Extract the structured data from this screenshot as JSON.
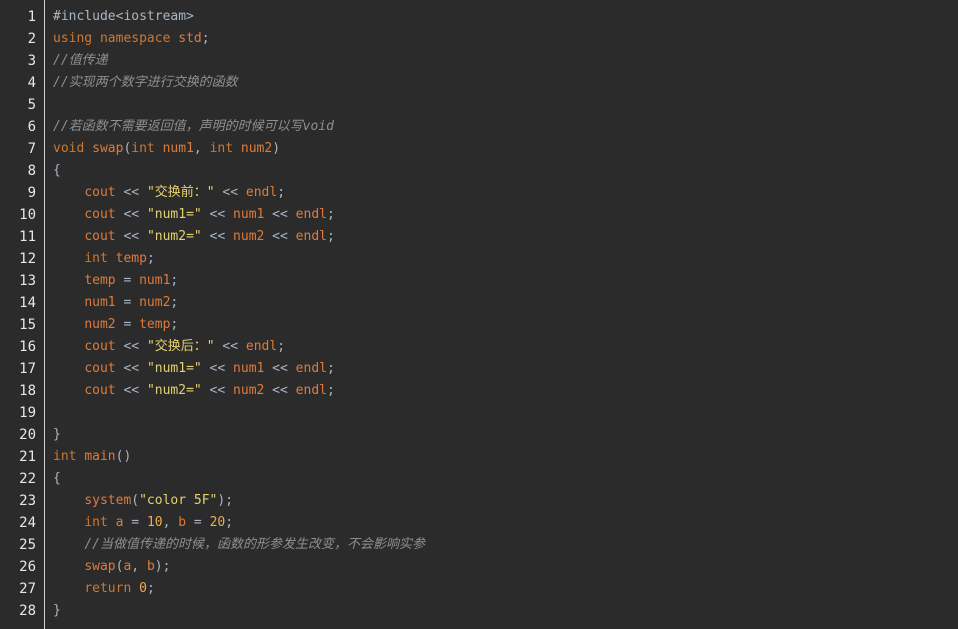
{
  "editor": {
    "colors": {
      "background": "#2b2b2b",
      "gutter_border": "#d0d0d0",
      "line_number": "#e8e8e8",
      "keyword": "#cc7832",
      "comment": "#8f8f8f",
      "string": "#e5d16f",
      "text": "#a9b7c6"
    },
    "lines": [
      {
        "n": "1",
        "tokens": [
          {
            "t": "#include<iostream>",
            "c": "k-pp"
          }
        ]
      },
      {
        "n": "2",
        "tokens": [
          {
            "t": "using",
            "c": "k-kw"
          },
          {
            "t": " ",
            "c": "k-tx"
          },
          {
            "t": "namespace",
            "c": "k-kw"
          },
          {
            "t": " ",
            "c": "k-tx"
          },
          {
            "t": "std",
            "c": "k-id"
          },
          {
            "t": ";",
            "c": "k-tx"
          }
        ]
      },
      {
        "n": "3",
        "tokens": [
          {
            "t": "//值传递",
            "c": "k-cm"
          }
        ]
      },
      {
        "n": "4",
        "tokens": [
          {
            "t": "//实现两个数字进行交换的函数",
            "c": "k-cm"
          }
        ]
      },
      {
        "n": "5",
        "tokens": []
      },
      {
        "n": "6",
        "tokens": [
          {
            "t": "//若函数不需要返回值，声明的时候可以写void",
            "c": "k-cm"
          }
        ]
      },
      {
        "n": "7",
        "tokens": [
          {
            "t": "void",
            "c": "k-kw"
          },
          {
            "t": " ",
            "c": "k-tx"
          },
          {
            "t": "swap",
            "c": "k-id"
          },
          {
            "t": "(",
            "c": "k-tx"
          },
          {
            "t": "int",
            "c": "k-kw"
          },
          {
            "t": " ",
            "c": "k-tx"
          },
          {
            "t": "num1",
            "c": "k-id"
          },
          {
            "t": ", ",
            "c": "k-tx"
          },
          {
            "t": "int",
            "c": "k-kw"
          },
          {
            "t": " ",
            "c": "k-tx"
          },
          {
            "t": "num2",
            "c": "k-id"
          },
          {
            "t": ")",
            "c": "k-tx"
          }
        ]
      },
      {
        "n": "8",
        "tokens": [
          {
            "t": "{",
            "c": "k-tx"
          }
        ]
      },
      {
        "n": "9",
        "tokens": [
          {
            "t": "    ",
            "c": "k-tx"
          },
          {
            "t": "cout",
            "c": "k-id"
          },
          {
            "t": " << ",
            "c": "k-tx"
          },
          {
            "t": "\"交换前：\"",
            "c": "k-str"
          },
          {
            "t": " << ",
            "c": "k-tx"
          },
          {
            "t": "endl",
            "c": "k-id"
          },
          {
            "t": ";",
            "c": "k-tx"
          }
        ]
      },
      {
        "n": "10",
        "tokens": [
          {
            "t": "    ",
            "c": "k-tx"
          },
          {
            "t": "cout",
            "c": "k-id"
          },
          {
            "t": " << ",
            "c": "k-tx"
          },
          {
            "t": "\"num1=\"",
            "c": "k-str"
          },
          {
            "t": " << ",
            "c": "k-tx"
          },
          {
            "t": "num1",
            "c": "k-id"
          },
          {
            "t": " << ",
            "c": "k-tx"
          },
          {
            "t": "endl",
            "c": "k-id"
          },
          {
            "t": ";",
            "c": "k-tx"
          }
        ]
      },
      {
        "n": "11",
        "tokens": [
          {
            "t": "    ",
            "c": "k-tx"
          },
          {
            "t": "cout",
            "c": "k-id"
          },
          {
            "t": " << ",
            "c": "k-tx"
          },
          {
            "t": "\"num2=\"",
            "c": "k-str"
          },
          {
            "t": " << ",
            "c": "k-tx"
          },
          {
            "t": "num2",
            "c": "k-id"
          },
          {
            "t": " << ",
            "c": "k-tx"
          },
          {
            "t": "endl",
            "c": "k-id"
          },
          {
            "t": ";",
            "c": "k-tx"
          }
        ]
      },
      {
        "n": "12",
        "tokens": [
          {
            "t": "    ",
            "c": "k-tx"
          },
          {
            "t": "int",
            "c": "k-kw"
          },
          {
            "t": " ",
            "c": "k-tx"
          },
          {
            "t": "temp",
            "c": "k-id"
          },
          {
            "t": ";",
            "c": "k-tx"
          }
        ]
      },
      {
        "n": "13",
        "tokens": [
          {
            "t": "    ",
            "c": "k-tx"
          },
          {
            "t": "temp",
            "c": "k-id"
          },
          {
            "t": " = ",
            "c": "k-tx"
          },
          {
            "t": "num1",
            "c": "k-id"
          },
          {
            "t": ";",
            "c": "k-tx"
          }
        ]
      },
      {
        "n": "14",
        "tokens": [
          {
            "t": "    ",
            "c": "k-tx"
          },
          {
            "t": "num1",
            "c": "k-id"
          },
          {
            "t": " = ",
            "c": "k-tx"
          },
          {
            "t": "num2",
            "c": "k-id"
          },
          {
            "t": ";",
            "c": "k-tx"
          }
        ]
      },
      {
        "n": "15",
        "tokens": [
          {
            "t": "    ",
            "c": "k-tx"
          },
          {
            "t": "num2",
            "c": "k-id"
          },
          {
            "t": " = ",
            "c": "k-tx"
          },
          {
            "t": "temp",
            "c": "k-id"
          },
          {
            "t": ";",
            "c": "k-tx"
          }
        ]
      },
      {
        "n": "16",
        "tokens": [
          {
            "t": "    ",
            "c": "k-tx"
          },
          {
            "t": "cout",
            "c": "k-id"
          },
          {
            "t": " << ",
            "c": "k-tx"
          },
          {
            "t": "\"交换后：\"",
            "c": "k-str"
          },
          {
            "t": " << ",
            "c": "k-tx"
          },
          {
            "t": "endl",
            "c": "k-id"
          },
          {
            "t": ";",
            "c": "k-tx"
          }
        ]
      },
      {
        "n": "17",
        "tokens": [
          {
            "t": "    ",
            "c": "k-tx"
          },
          {
            "t": "cout",
            "c": "k-id"
          },
          {
            "t": " << ",
            "c": "k-tx"
          },
          {
            "t": "\"num1=\"",
            "c": "k-str"
          },
          {
            "t": " << ",
            "c": "k-tx"
          },
          {
            "t": "num1",
            "c": "k-id"
          },
          {
            "t": " << ",
            "c": "k-tx"
          },
          {
            "t": "endl",
            "c": "k-id"
          },
          {
            "t": ";",
            "c": "k-tx"
          }
        ]
      },
      {
        "n": "18",
        "tokens": [
          {
            "t": "    ",
            "c": "k-tx"
          },
          {
            "t": "cout",
            "c": "k-id"
          },
          {
            "t": " << ",
            "c": "k-tx"
          },
          {
            "t": "\"num2=\"",
            "c": "k-str"
          },
          {
            "t": " << ",
            "c": "k-tx"
          },
          {
            "t": "num2",
            "c": "k-id"
          },
          {
            "t": " << ",
            "c": "k-tx"
          },
          {
            "t": "endl",
            "c": "k-id"
          },
          {
            "t": ";",
            "c": "k-tx"
          }
        ]
      },
      {
        "n": "19",
        "tokens": []
      },
      {
        "n": "20",
        "tokens": [
          {
            "t": "}",
            "c": "k-tx"
          }
        ]
      },
      {
        "n": "21",
        "tokens": [
          {
            "t": "int",
            "c": "k-kw"
          },
          {
            "t": " ",
            "c": "k-tx"
          },
          {
            "t": "main",
            "c": "k-id"
          },
          {
            "t": "()",
            "c": "k-tx"
          }
        ]
      },
      {
        "n": "22",
        "tokens": [
          {
            "t": "{",
            "c": "k-tx"
          }
        ]
      },
      {
        "n": "23",
        "tokens": [
          {
            "t": "    ",
            "c": "k-tx"
          },
          {
            "t": "system",
            "c": "k-id"
          },
          {
            "t": "(",
            "c": "k-tx"
          },
          {
            "t": "\"color 5F\"",
            "c": "k-str"
          },
          {
            "t": ");",
            "c": "k-tx"
          }
        ]
      },
      {
        "n": "24",
        "tokens": [
          {
            "t": "    ",
            "c": "k-tx"
          },
          {
            "t": "int",
            "c": "k-kw"
          },
          {
            "t": " ",
            "c": "k-tx"
          },
          {
            "t": "a",
            "c": "k-id"
          },
          {
            "t": " = ",
            "c": "k-tx"
          },
          {
            "t": "10",
            "c": "k-num"
          },
          {
            "t": ", ",
            "c": "k-tx"
          },
          {
            "t": "b",
            "c": "k-id"
          },
          {
            "t": " = ",
            "c": "k-tx"
          },
          {
            "t": "20",
            "c": "k-num"
          },
          {
            "t": ";",
            "c": "k-tx"
          }
        ]
      },
      {
        "n": "25",
        "tokens": [
          {
            "t": "    ",
            "c": "k-tx"
          },
          {
            "t": "//当做值传递的时候，函数的形参发生改变，不会影响实参",
            "c": "k-cm"
          }
        ]
      },
      {
        "n": "26",
        "tokens": [
          {
            "t": "    ",
            "c": "k-tx"
          },
          {
            "t": "swap",
            "c": "k-id"
          },
          {
            "t": "(",
            "c": "k-tx"
          },
          {
            "t": "a",
            "c": "k-id"
          },
          {
            "t": ", ",
            "c": "k-tx"
          },
          {
            "t": "b",
            "c": "k-id"
          },
          {
            "t": ");",
            "c": "k-tx"
          }
        ]
      },
      {
        "n": "27",
        "tokens": [
          {
            "t": "    ",
            "c": "k-tx"
          },
          {
            "t": "return",
            "c": "k-kw"
          },
          {
            "t": " ",
            "c": "k-tx"
          },
          {
            "t": "0",
            "c": "k-num"
          },
          {
            "t": ";",
            "c": "k-tx"
          }
        ]
      },
      {
        "n": "28",
        "tokens": [
          {
            "t": "}",
            "c": "k-tx"
          }
        ]
      }
    ]
  }
}
